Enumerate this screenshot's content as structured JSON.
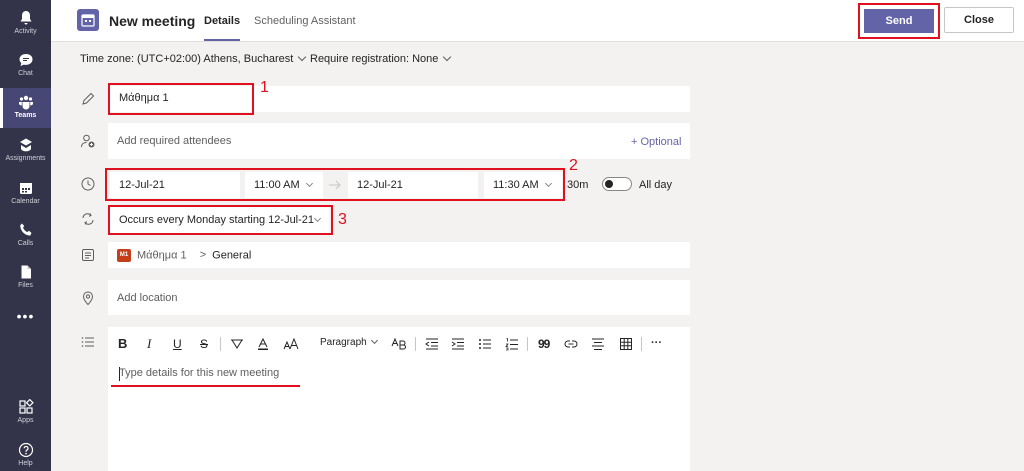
{
  "rail": {
    "items": [
      {
        "label": "Activity",
        "icon": "bell-icon"
      },
      {
        "label": "Chat",
        "icon": "chat-icon"
      },
      {
        "label": "Teams",
        "icon": "teams-icon"
      },
      {
        "label": "Assignments",
        "icon": "assignments-icon"
      },
      {
        "label": "Calendar",
        "icon": "calendar-icon"
      },
      {
        "label": "Calls",
        "icon": "phone-icon"
      },
      {
        "label": "Files",
        "icon": "file-icon"
      }
    ],
    "more": "•••",
    "bottom": [
      {
        "label": "Apps",
        "icon": "apps-icon"
      },
      {
        "label": "Help",
        "icon": "help-icon"
      }
    ]
  },
  "header": {
    "title": "New meeting",
    "tabs": [
      "Details",
      "Scheduling Assistant"
    ],
    "send_label": "Send",
    "close_label": "Close"
  },
  "subbar": {
    "timezone": "Time zone: (UTC+02:00) Athens, Bucharest",
    "registration": "Require registration: None"
  },
  "form": {
    "title_value": "Μάθημα 1",
    "attendees_placeholder": "Add required attendees",
    "optional_label": "+ Optional",
    "start_date": "12-Jul-21",
    "start_time": "11:00 AM",
    "end_date": "12-Jul-21",
    "end_time": "11:30 AM",
    "duration": "30m",
    "all_day_label": "All day",
    "recurrence": "Occurs every Monday starting 12-Jul-21",
    "channel_badge": "M1",
    "channel_team": "Μάθημα 1",
    "channel_separator": ">",
    "channel_name": "General",
    "location_placeholder": "Add location",
    "details_placeholder": "Type details for this new meeting"
  },
  "toolbar": {
    "bold": "B",
    "italic": "I",
    "underline": "U",
    "strike": "S",
    "paragraph": "Paragraph",
    "more": "···",
    "quote": "99"
  },
  "annotations": [
    "1",
    "2",
    "3"
  ],
  "colors": {
    "brand": "#6264a7",
    "rail": "#33344a",
    "annotation": "#e0101e"
  }
}
